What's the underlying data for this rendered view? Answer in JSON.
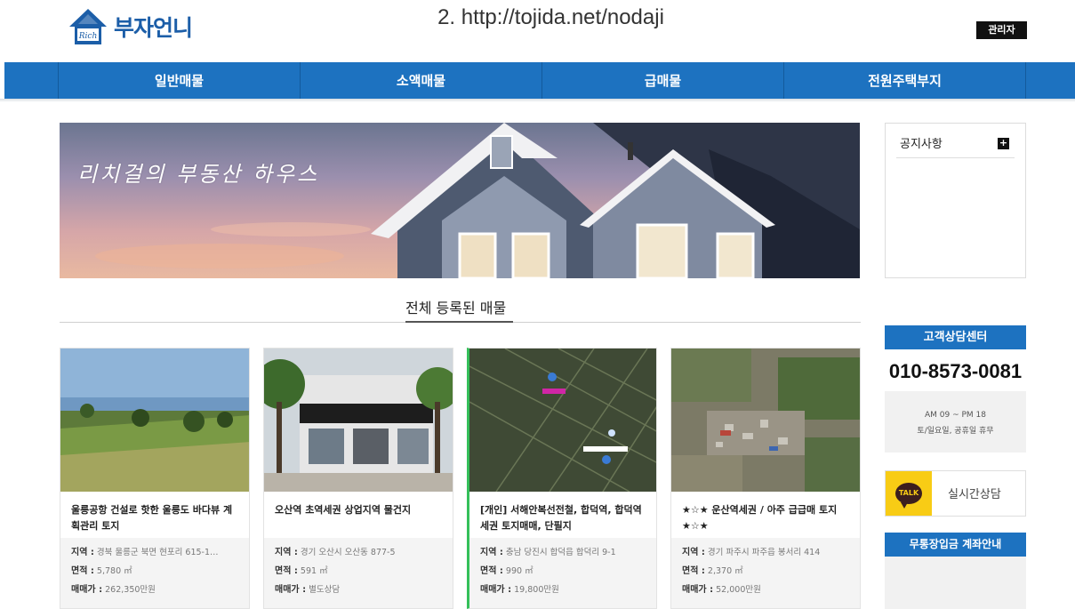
{
  "header": {
    "logo_text": "부자언니",
    "logo_badge": "Rich",
    "url_caption": "2. http://tojida.net/nodaji",
    "admin_label": "관리자"
  },
  "nav": {
    "items": [
      {
        "label": "일반매물"
      },
      {
        "label": "소액매물"
      },
      {
        "label": "급매물"
      },
      {
        "label": "전원주택부지"
      }
    ]
  },
  "banner": {
    "text": "리치걸의 부동산 하우스"
  },
  "section": {
    "title": "전체 등록된 매물"
  },
  "listings": [
    {
      "title": "울릉공항 건설로 핫한 울릉도 바다뷰 계획관리 토지",
      "region_label": "지역 :",
      "region": "경북 울릉군 북면 현포리 615-1…",
      "area_label": "면적 :",
      "area": "5,780 ㎡",
      "price_label": "매매가 :",
      "price": "262,350만원"
    },
    {
      "title": "오산역 초역세권 상업지역 물건지",
      "region_label": "지역 :",
      "region": "경기 오산시 오산동 877-5",
      "area_label": "면적 :",
      "area": "591 ㎡",
      "price_label": "매매가 :",
      "price": "별도상담"
    },
    {
      "title": "[개인] 서해안복선전철, 합덕역, 합덕역세권 토지매매, 단필지",
      "region_label": "지역 :",
      "region": "충남 당진시 합덕읍 합덕리 9-1",
      "area_label": "면적 :",
      "area": "990 ㎡",
      "price_label": "매매가 :",
      "price": "19,800만원"
    },
    {
      "title": "★☆★ 운산역세권 / 아주 급급매 토지 ★☆★",
      "region_label": "지역 :",
      "region": "경기 파주시 파주읍 봉서리 414",
      "area_label": "면적 :",
      "area": "2,370 ㎡",
      "price_label": "매매가 :",
      "price": "52,000만원"
    }
  ],
  "sidebar": {
    "notice_title": "공지사항",
    "notice_more": "+",
    "cs_title": "고객상담센터",
    "cs_phone": "010-8573-0081",
    "cs_hours_1": "AM 09 ~ PM 18",
    "cs_hours_2": "토/일요일, 공휴일 휴무",
    "kakao_badge": "TALK",
    "kakao_label": "실시간상담",
    "bank_title": "무통장입금 계좌안내"
  },
  "colors": {
    "brand_blue": "#1d72c0",
    "kakao_yellow": "#f8cc15"
  }
}
